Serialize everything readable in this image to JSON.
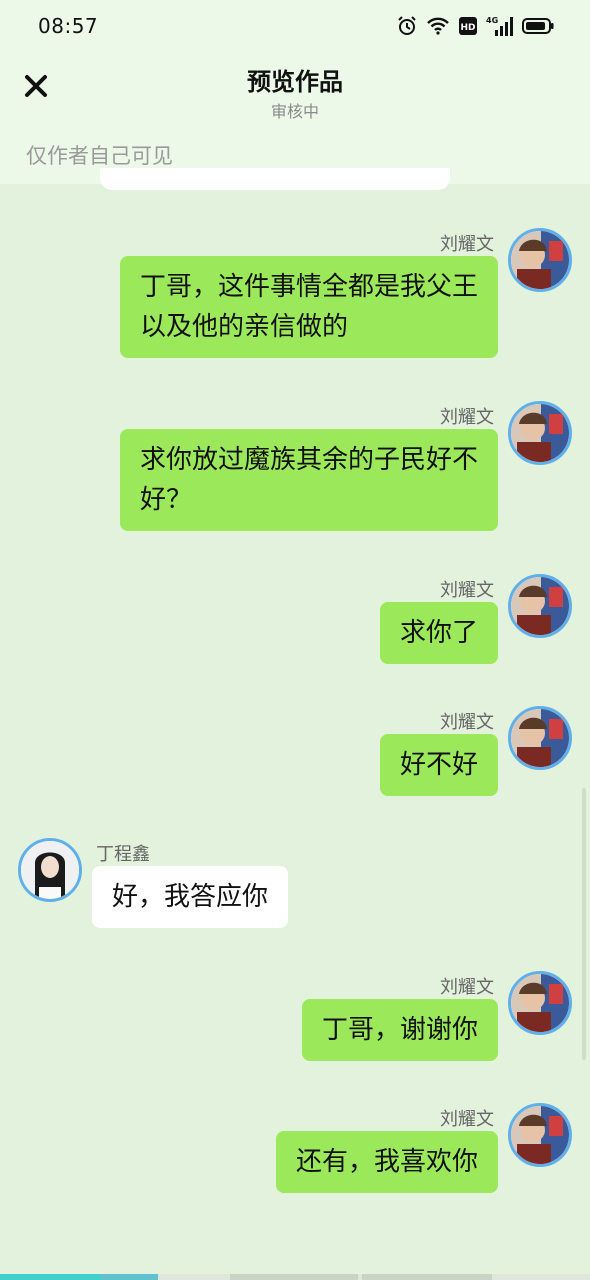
{
  "status": {
    "time": "08:57",
    "icons": [
      "alarm-icon",
      "wifi-icon",
      "hd-icon",
      "4g-signal-icon",
      "battery-icon"
    ]
  },
  "header": {
    "title": "预览作品",
    "subtitle": "审核中",
    "close_icon": "close-icon"
  },
  "note": "仅作者自己可见",
  "messages": [
    {
      "side": "right",
      "sender": "刘耀文",
      "text_lines": [
        "丁哥，这件事情全都是我父王",
        "以及他的亲信做的"
      ]
    },
    {
      "side": "right",
      "sender": "刘耀文",
      "text_lines": [
        "求你放过魔族其余的子民好不",
        "好？"
      ]
    },
    {
      "side": "right",
      "sender": "刘耀文",
      "text_lines": [
        "求你了"
      ]
    },
    {
      "side": "right",
      "sender": "刘耀文",
      "text_lines": [
        "好不好"
      ]
    },
    {
      "side": "left",
      "sender": "丁程鑫",
      "text_lines": [
        "好，我答应你"
      ]
    },
    {
      "side": "right",
      "sender": "刘耀文",
      "text_lines": [
        "丁哥，谢谢你"
      ]
    },
    {
      "side": "right",
      "sender": "刘耀文",
      "text_lines": [
        "还有，我喜欢你"
      ]
    }
  ],
  "colors": {
    "accent": "#9be85a",
    "avatar_ring": "#5fb0ea",
    "progress_active": "#3fd0cf"
  }
}
